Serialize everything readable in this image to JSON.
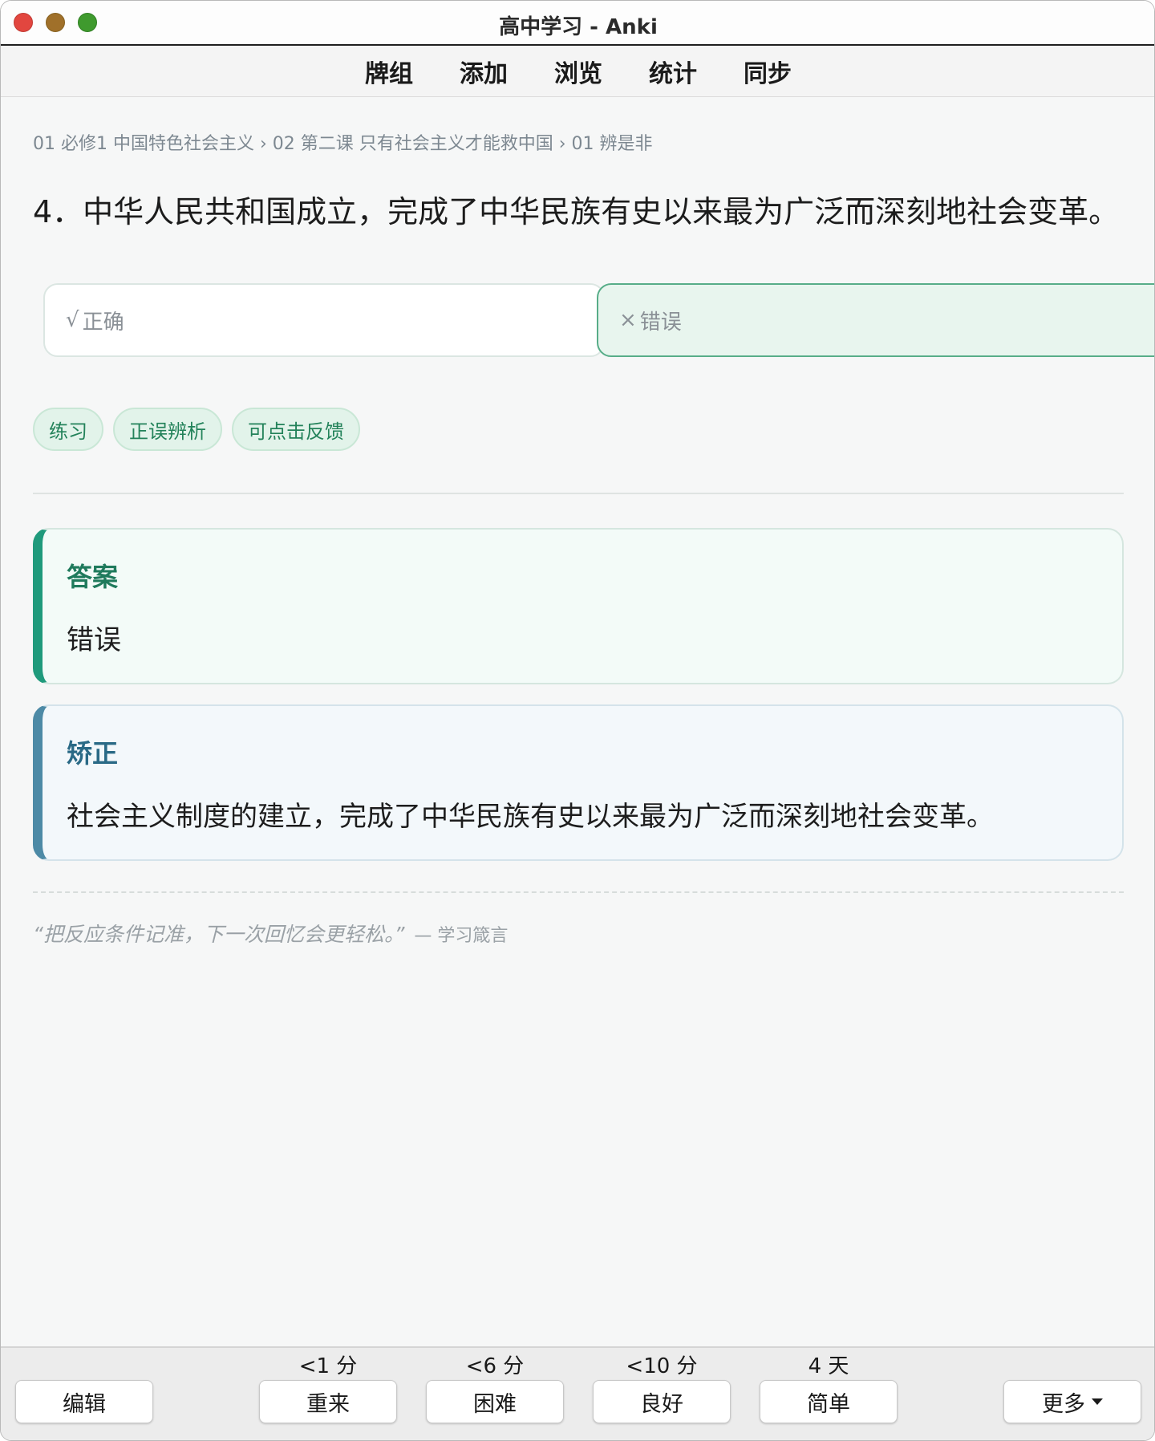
{
  "window": {
    "title": "高中学习 - Anki"
  },
  "toolbar": {
    "items": [
      "牌组",
      "添加",
      "浏览",
      "统计",
      "同步"
    ]
  },
  "card": {
    "breadcrumb": "01 必修1 中国特色社会主义 › 02 第二课 只有社会主义才能救中国 › 01 辨是非",
    "question": "4．中华人民共和国成立，完成了中华民族有史以来最为广泛而深刻地社会变革。",
    "options": {
      "correct": {
        "mark": "√",
        "label": "正确"
      },
      "wrong": {
        "mark": "×",
        "label": "错误"
      }
    },
    "tags": [
      "练习",
      "正误辨析",
      "可点击反馈"
    ],
    "answer": {
      "title": "答案",
      "body": "错误"
    },
    "correction": {
      "title": "矫正",
      "body": "社会主义制度的建立，完成了中华民族有史以来最为广泛而深刻地社会变革。"
    },
    "quote": {
      "text": "“把反应条件记准，下一次回忆会更轻松。”",
      "source": "— 学习箴言"
    }
  },
  "bottom": {
    "edit": "编辑",
    "more": "更多",
    "answers": [
      {
        "label": "重来",
        "interval": "<1 分"
      },
      {
        "label": "困难",
        "interval": "<6 分"
      },
      {
        "label": "良好",
        "interval": "<10 分"
      },
      {
        "label": "简单",
        "interval": "4 天"
      }
    ]
  },
  "colors": {
    "accent_green": "#1f9a7c",
    "accent_blue": "#4d8aa6",
    "traffic_close": "#e2463f",
    "traffic_min": "#a0702a",
    "traffic_max": "#3f9a2e"
  }
}
